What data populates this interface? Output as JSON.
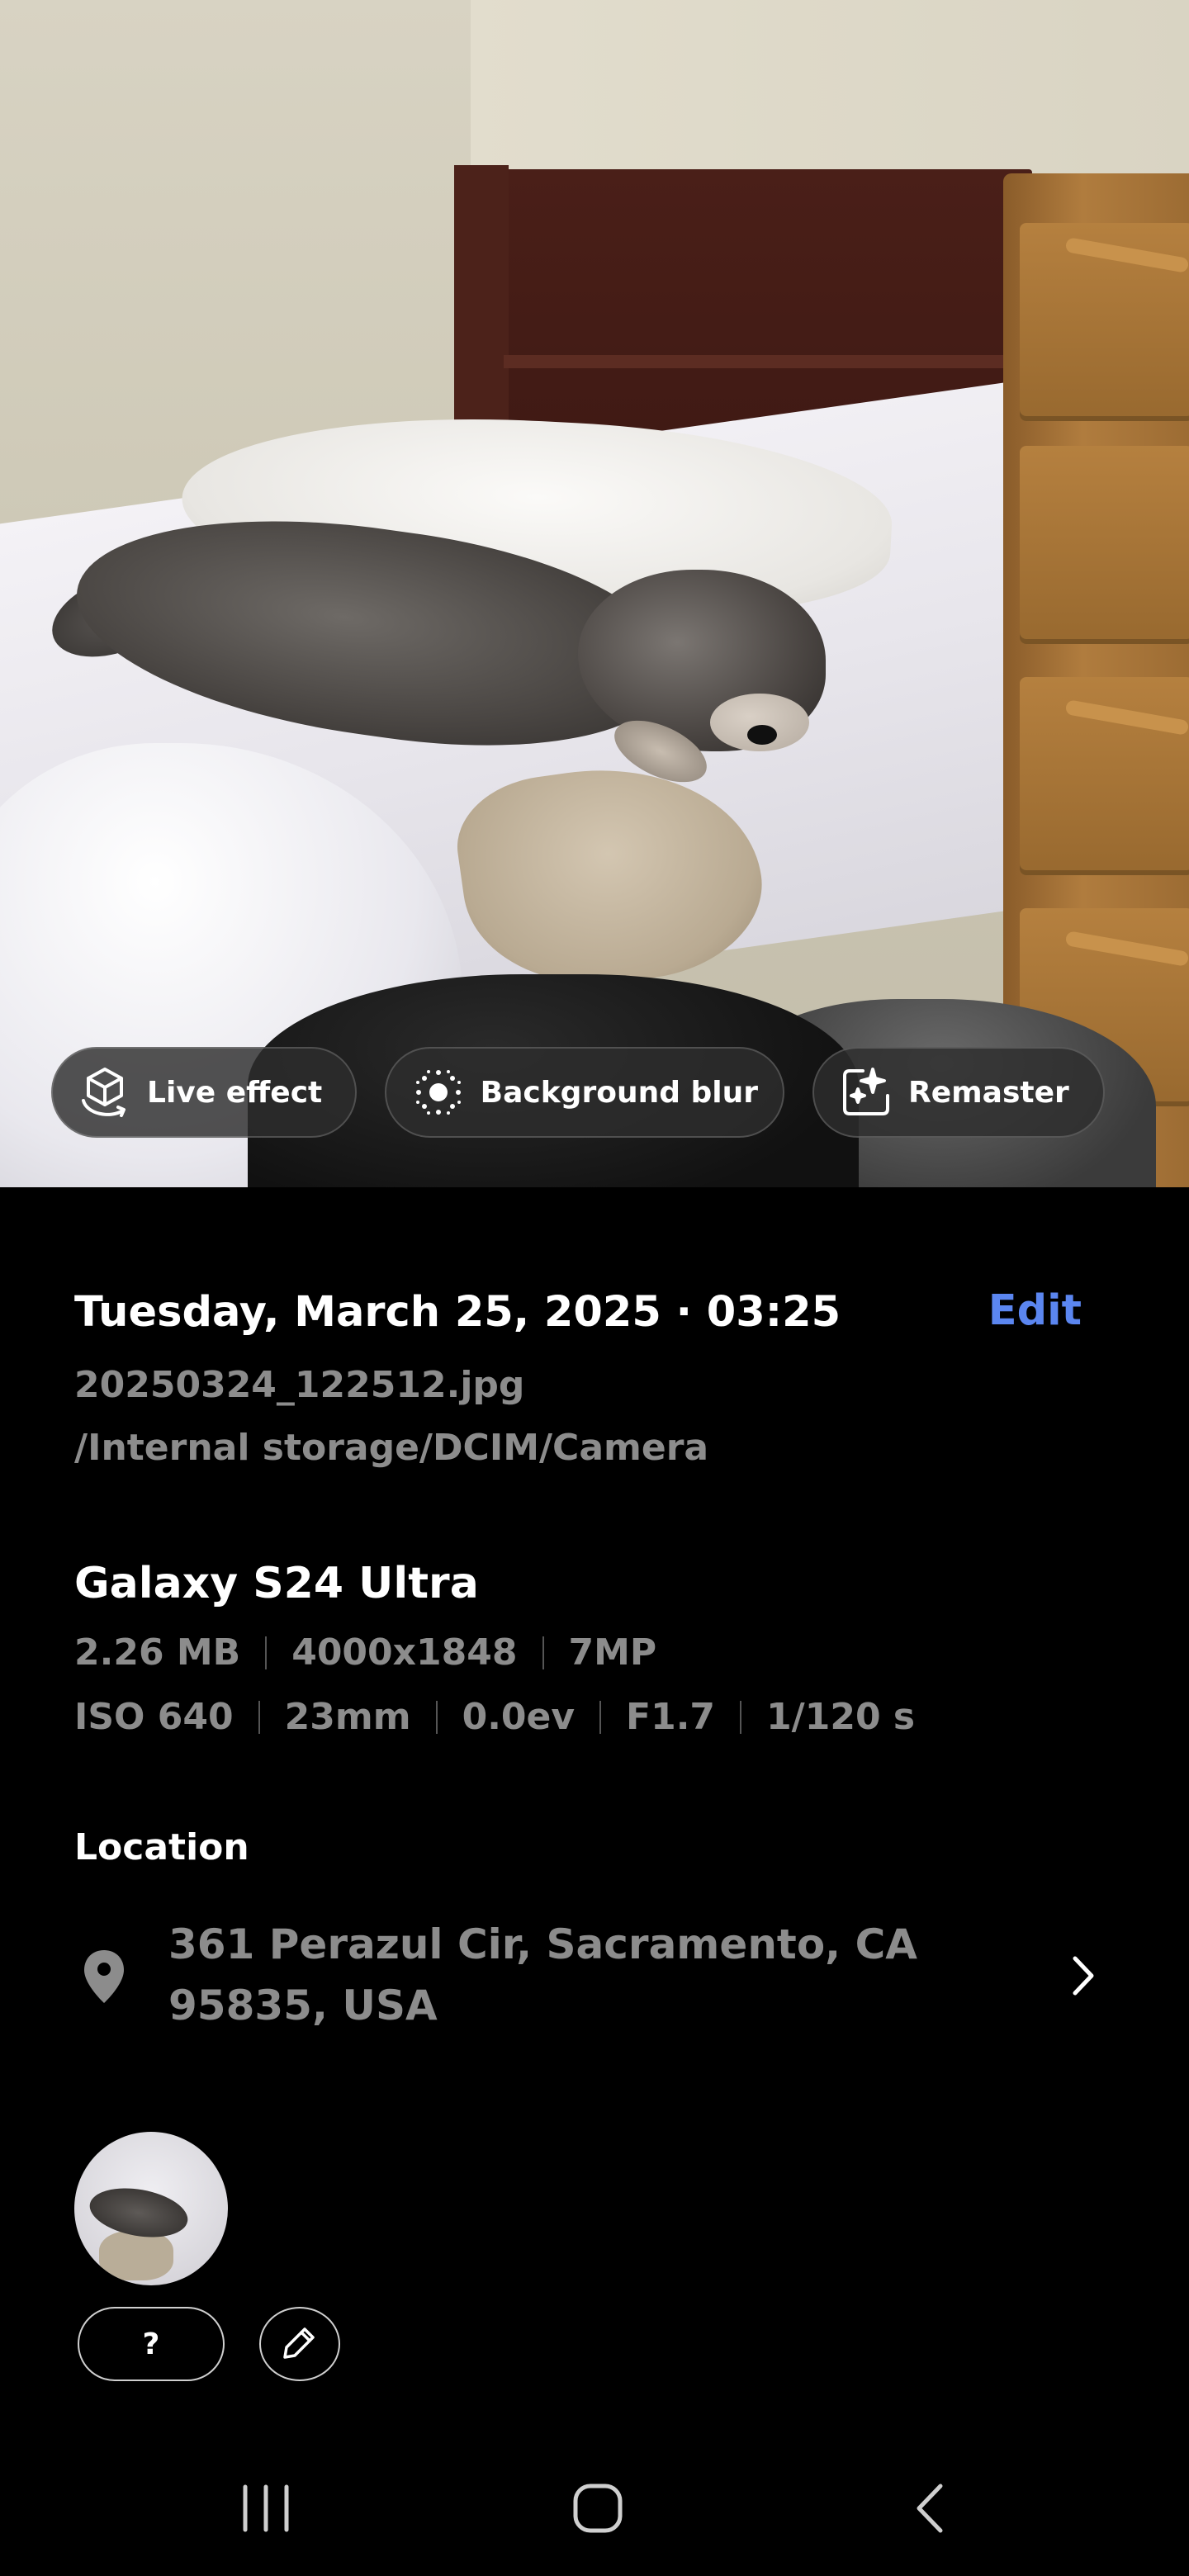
{
  "photo": {
    "subject": "dog sleeping on bed"
  },
  "chips": {
    "live_effect": "Live effect",
    "background_blur": "Background blur",
    "remaster": "Remaster"
  },
  "details": {
    "date_time": "Tuesday, March 25, 2025 · 03:25",
    "edit": "Edit",
    "filename": "20250324_122512.jpg",
    "path": "/Internal storage/DCIM/Camera",
    "device": "Galaxy S24 Ultra",
    "specs_row1": [
      "2.26 MB",
      "4000x1848",
      "7MP"
    ],
    "specs_row2": [
      "ISO 640",
      "23mm",
      "0.0ev",
      "F1.7",
      "1/120 s"
    ]
  },
  "location": {
    "title": "Location",
    "address_line1": "361 Perazul Cir, Sacramento, CA",
    "address_line2": "95835, USA"
  },
  "tags": {
    "unknown_label": "?"
  },
  "icons": {
    "live_effect": "cube-sparkle-icon",
    "background_blur": "blur-dots-icon",
    "remaster": "sparkle-frame-icon",
    "location": "map-pin-icon",
    "chevron": "chevron-right-icon",
    "edit_tag": "pencil-icon",
    "nav_recents": "recents-icon",
    "nav_home": "home-icon",
    "nav_back": "back-icon"
  },
  "colors": {
    "accent": "#5b86f0",
    "background": "#000000",
    "muted_text": "#8c8c8c"
  }
}
